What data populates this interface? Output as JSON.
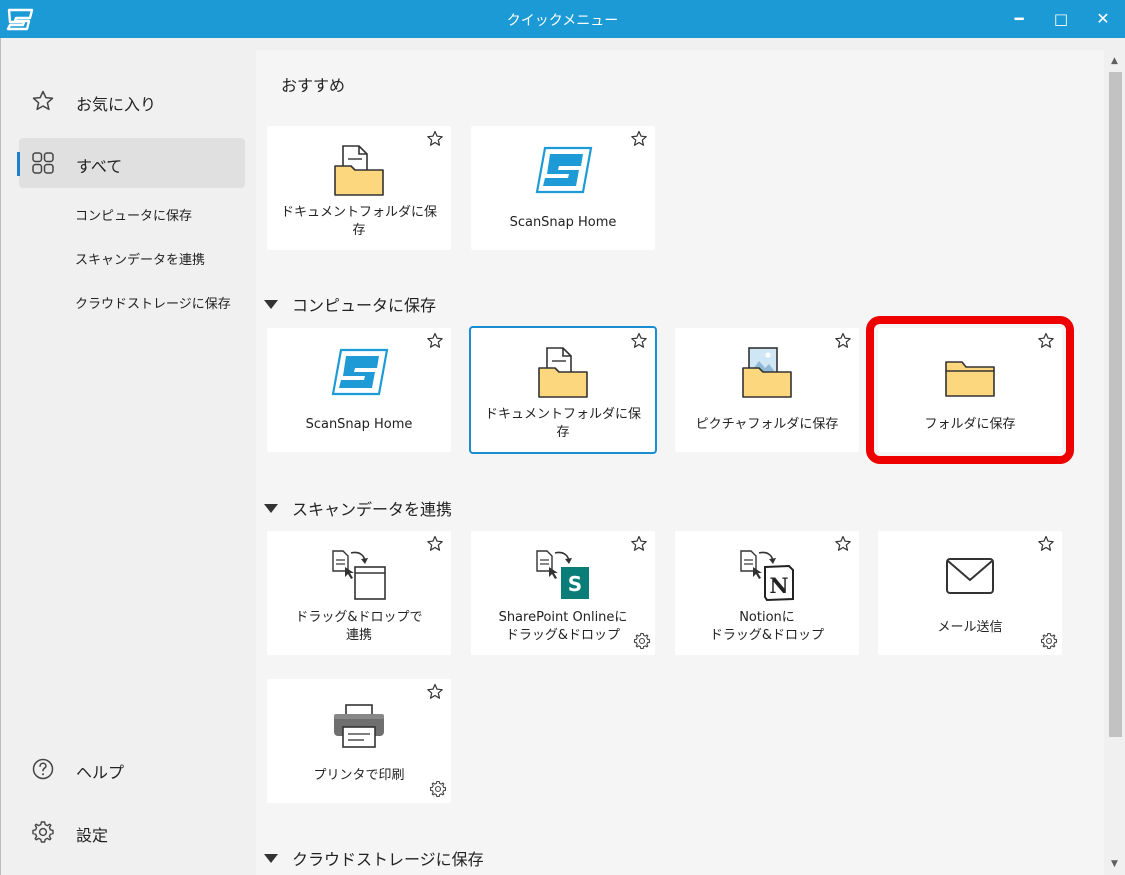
{
  "window": {
    "title": "クイックメニュー",
    "accent_color": "#1b9ad6",
    "minimize_icon": "minimize-icon",
    "maximize_icon": "maximize-icon",
    "close_icon": "close-icon"
  },
  "sidebar": {
    "favorites_label": "お気に入り",
    "all_label": "すべて",
    "sub_items": [
      "コンピュータに保存",
      "スキャンデータを連携",
      "クラウドストレージに保存"
    ],
    "help_label": "ヘルプ",
    "settings_label": "設定"
  },
  "main": {
    "recommended_title": "おすすめ",
    "recommended": [
      {
        "label": "ドキュメントフォルダに保\n存",
        "icon": "document-folder-icon"
      },
      {
        "label": "ScanSnap Home",
        "icon": "scansnap-icon"
      }
    ],
    "sections": [
      {
        "title": "コンピュータに保存",
        "cards": [
          {
            "label": "ScanSnap Home",
            "icon": "scansnap-icon"
          },
          {
            "label": "ドキュメントフォルダに保\n存",
            "icon": "document-folder-icon",
            "selected": true
          },
          {
            "label": "ピクチャフォルダに保存",
            "icon": "picture-folder-icon"
          },
          {
            "label": "フォルダに保存",
            "icon": "folder-icon",
            "highlighted": true
          }
        ]
      },
      {
        "title": "スキャンデータを連携",
        "cards": [
          {
            "label": "ドラッグ&ドロップで\n連携",
            "icon": "drag-drop-icon"
          },
          {
            "label": "SharePoint Onlineに\nドラッグ&ドロップ",
            "icon": "sharepoint-icon",
            "has_settings": true
          },
          {
            "label": "Notionに\nドラッグ&ドロップ",
            "icon": "notion-icon"
          },
          {
            "label": "メール送信",
            "icon": "mail-icon",
            "has_settings": true
          },
          {
            "label": "プリンタで印刷",
            "icon": "printer-icon",
            "has_settings": true
          }
        ]
      },
      {
        "title": "クラウドストレージに保存",
        "cards": []
      }
    ]
  },
  "colors": {
    "highlight_border": "#ee0000",
    "selected_border": "#1b8ed3",
    "folder_fill": "#fcd77e"
  }
}
